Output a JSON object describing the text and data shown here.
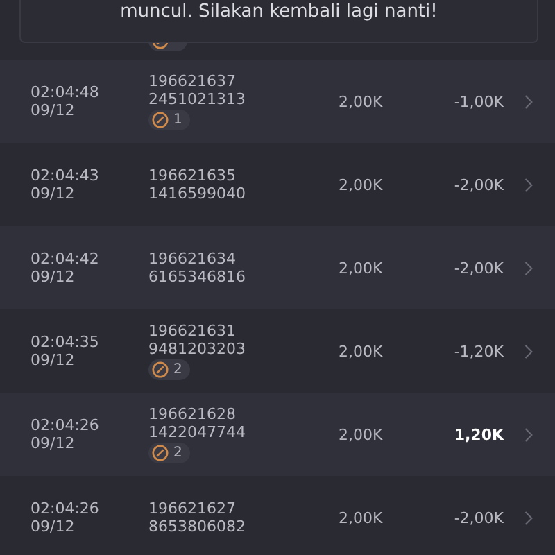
{
  "toast": {
    "message": "muncul. Silakan kembali lagi nanti!"
  },
  "rows": [
    {
      "time": "02:04:48",
      "date": "09/12",
      "id": "196621637",
      "ref": "2451021313",
      "badge": "1",
      "amount": "2,00K",
      "result": "-1,00K",
      "highlight": false
    },
    {
      "time": "02:04:43",
      "date": "09/12",
      "id": "196621635",
      "ref": "1416599040",
      "amount": "2,00K",
      "result": "-2,00K",
      "highlight": false
    },
    {
      "time": "02:04:42",
      "date": "09/12",
      "id": "196621634",
      "ref": "6165346816",
      "amount": "2,00K",
      "result": "-2,00K",
      "highlight": false
    },
    {
      "time": "02:04:35",
      "date": "09/12",
      "id": "196621631",
      "ref": "9481203203",
      "badge": "2",
      "amount": "2,00K",
      "result": "-1,20K",
      "highlight": false
    },
    {
      "time": "02:04:26",
      "date": "09/12",
      "id": "196621628",
      "ref": "1422047744",
      "badge": "2",
      "amount": "2,00K",
      "result": "1,20K",
      "highlight": true
    },
    {
      "time": "02:04:26",
      "date": "09/12",
      "id": "196621627",
      "ref": "8653806082",
      "amount": "2,00K",
      "result": "-2,00K",
      "highlight": false
    }
  ]
}
